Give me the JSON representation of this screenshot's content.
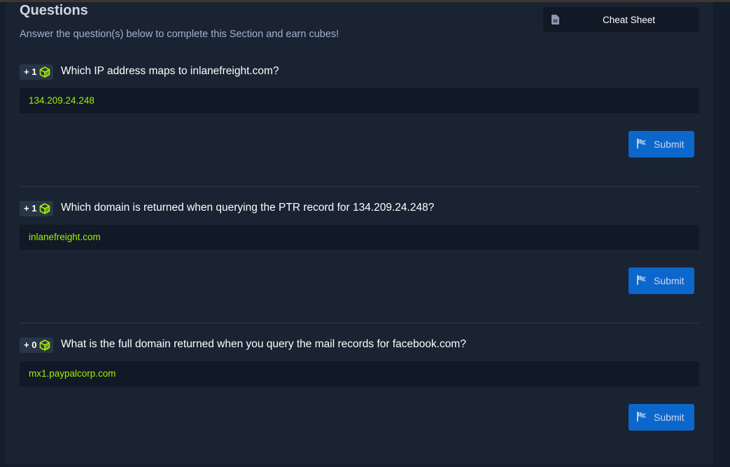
{
  "section": {
    "title": "Questions",
    "subtitle": "Answer the question(s) below to complete this Section and earn cubes!",
    "cheat_sheet_label": "Cheat Sheet"
  },
  "questions": [
    {
      "points": "+ 1",
      "text": "Which IP address maps to inlanefreight.com?",
      "answer": "134.209.24.248",
      "submit_label": "Submit"
    },
    {
      "points": "+ 1",
      "text": "Which domain is returned when querying the PTR record for 134.209.24.248?",
      "answer": "inlanefreight.com",
      "submit_label": "Submit"
    },
    {
      "points": "+ 0",
      "text": "What is the full domain returned when you query the mail records for facebook.com?",
      "answer": "mx1.paypalcorp.com",
      "submit_label": "Submit"
    }
  ],
  "colors": {
    "background": "#141d2b",
    "panel": "#1a2332",
    "answer_text": "#9fef00",
    "submit_button": "#0c67cc",
    "cube": "#9fef00"
  },
  "icons": {
    "cheat_sheet": "document-icon",
    "points": "cube-icon",
    "submit": "flag-icon"
  }
}
